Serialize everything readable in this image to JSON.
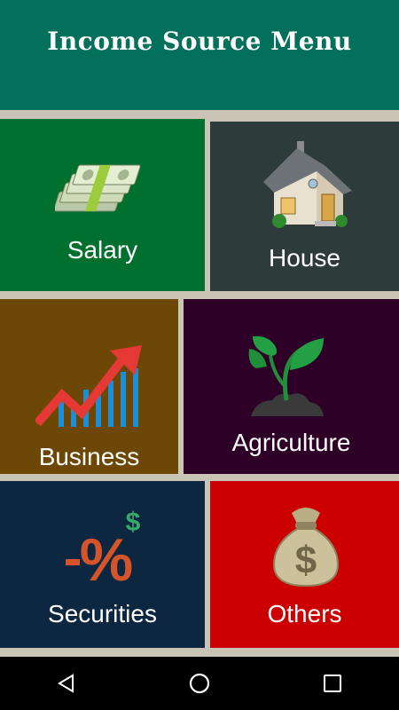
{
  "header": {
    "title": "Income Source Menu"
  },
  "tiles": {
    "salary": {
      "label": "Salary",
      "icon": "money-stack-icon"
    },
    "house": {
      "label": "House",
      "icon": "house-icon"
    },
    "business": {
      "label": "Business",
      "icon": "growth-chart-icon"
    },
    "agriculture": {
      "label": "Agriculture",
      "icon": "sprout-icon"
    },
    "securities": {
      "label": "Securities",
      "icon": "percent-dollar-icon"
    },
    "others": {
      "label": "Others",
      "icon": "money-bag-icon"
    }
  },
  "navbar": {
    "back": "back-icon",
    "home": "home-icon",
    "recents": "recents-icon"
  },
  "colors": {
    "header": "#02705a",
    "salary": "#00702f",
    "house": "#2d3b3a",
    "business": "#6c4705",
    "agriculture": "#2e0028",
    "securities": "#0d2740",
    "others": "#cc0000"
  }
}
